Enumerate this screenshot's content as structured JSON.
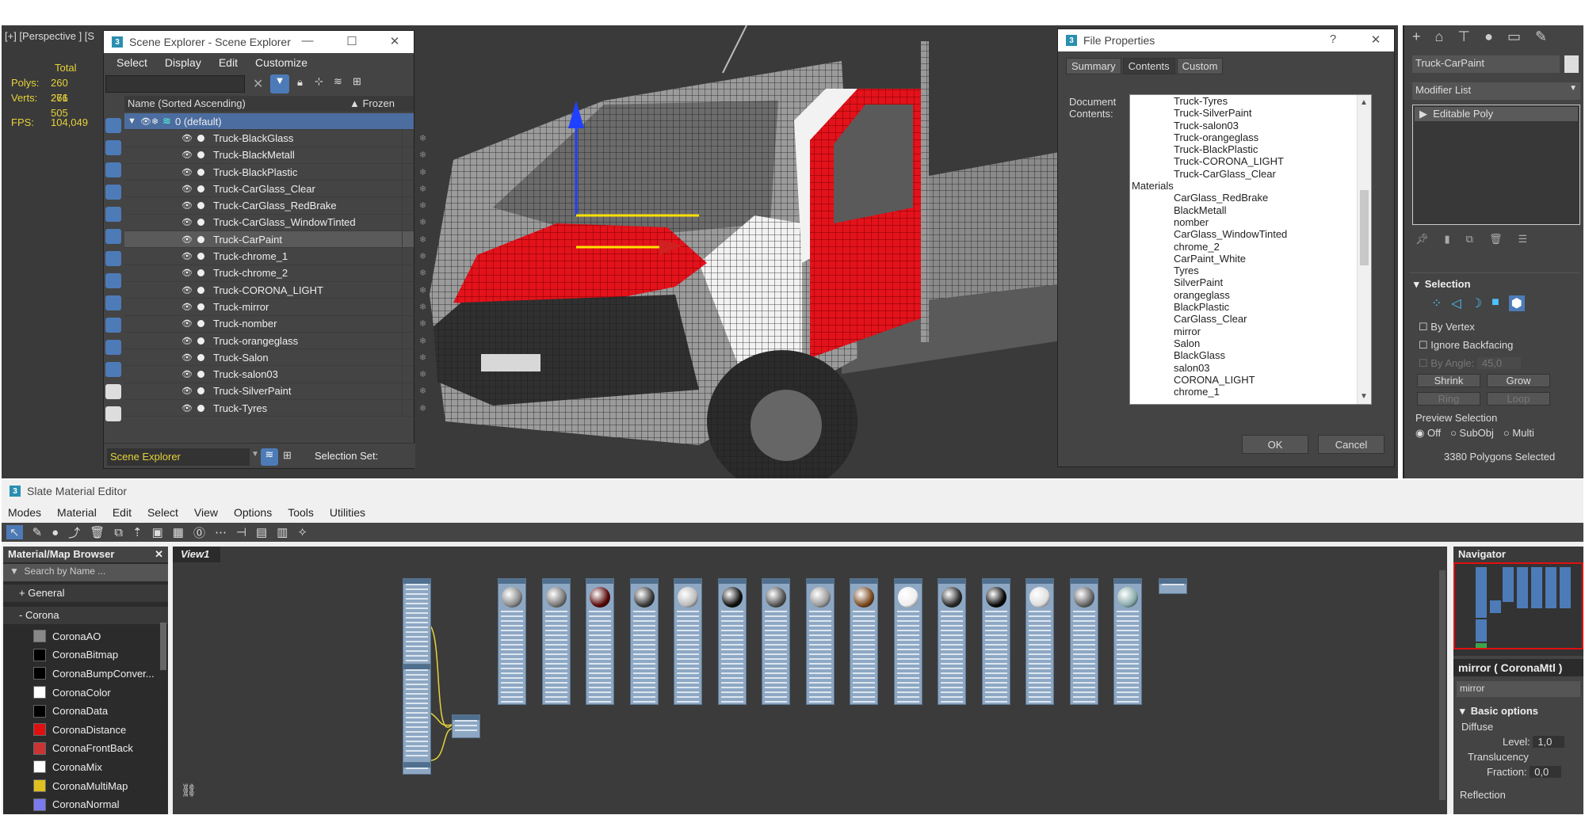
{
  "viewport": {
    "label": "[+] [Perspective ] [S",
    "stats": {
      "header": "Total",
      "polys_label": "Polys:",
      "polys": "260 261",
      "verts_label": "Verts:",
      "verts": "276 505",
      "fps_label": "FPS:",
      "fps": "104,049"
    }
  },
  "scene_explorer": {
    "title": "Scene Explorer - Scene Explorer",
    "menu": [
      "Select",
      "Display",
      "Edit",
      "Customize"
    ],
    "col_name": "Name (Sorted Ascending)",
    "col_frozen": "Frozen",
    "root": "0 (default)",
    "items": [
      "Truck-BlackGlass",
      "Truck-BlackMetall",
      "Truck-BlackPlastic",
      "Truck-CarGlass_Clear",
      "Truck-CarGlass_RedBrake",
      "Truck-CarGlass_WindowTinted",
      "Truck-CarPaint",
      "Truck-chrome_1",
      "Truck-chrome_2",
      "Truck-CORONA_LIGHT",
      "Truck-mirror",
      "Truck-nomber",
      "Truck-orangeglass",
      "Truck-Salon",
      "Truck-salon03",
      "Truck-SilverPaint",
      "Truck-Tyres"
    ],
    "selected_index": 6,
    "footer_dropdown": "Scene Explorer",
    "selection_set": "Selection Set:",
    "snow": "❄"
  },
  "file_props": {
    "title": "File Properties",
    "tabs": [
      "Summary",
      "Contents",
      "Custom"
    ],
    "active_tab": "Contents",
    "doc_label": "Document\nContents:",
    "list_top": [
      "Truck-Tyres",
      "Truck-SilverPaint",
      "Truck-salon03",
      "Truck-orangeglass",
      "Truck-BlackPlastic",
      "Truck-CORONA_LIGHT",
      "Truck-CarGlass_Clear"
    ],
    "materials_header": "Materials",
    "materials": [
      "CarGlass_RedBrake",
      "BlackMetall",
      "nomber",
      "CarGlass_WindowTinted",
      "chrome_2",
      "CarPaint_White",
      "Tyres",
      "SilverPaint",
      "orangeglass",
      "BlackPlastic",
      "CarGlass_Clear",
      "mirror",
      "Salon",
      "BlackGlass",
      "salon03",
      "CORONA_LIGHT",
      "chrome_1"
    ],
    "ok": "OK",
    "cancel": "Cancel"
  },
  "command_panel": {
    "object_name": "Truck-CarPaint",
    "modifier_list": "Modifier List",
    "stack_item": "Editable Poly",
    "selection_header": "Selection",
    "by_vertex": "By Vertex",
    "ignore_backfacing": "Ignore Backfacing",
    "by_angle": "By Angle:",
    "angle_value": "45,0",
    "shrink": "Shrink",
    "grow": "Grow",
    "ring": "Ring",
    "loop": "Loop",
    "preview_label": "Preview Selection",
    "preview_opts": [
      "Off",
      "SubObj",
      "Multi"
    ],
    "status": "3380 Polygons Selected"
  },
  "sme": {
    "title": "Slate Material Editor",
    "menu": [
      "Modes",
      "Material",
      "Edit",
      "Select",
      "View",
      "Options",
      "Tools",
      "Utilities"
    ],
    "browser_title": "Material/Map Browser",
    "search_placeholder": "Search by Name ...",
    "general": "+ General",
    "corona": "- Corona",
    "maps": [
      {
        "name": "CoronaAO",
        "color": "#888888"
      },
      {
        "name": "CoronaBitmap",
        "color": "#000000"
      },
      {
        "name": "CoronaBumpConver...",
        "color": "#000000"
      },
      {
        "name": "CoronaColor",
        "color": "#ffffff"
      },
      {
        "name": "CoronaData",
        "color": "#000000"
      },
      {
        "name": "CoronaDistance",
        "color": "#e01010"
      },
      {
        "name": "CoronaFrontBack",
        "color": "#cc3333"
      },
      {
        "name": "CoronaMix",
        "color": "#ffffff"
      },
      {
        "name": "CoronaMultiMap",
        "color": "#e0c020"
      },
      {
        "name": "CoronaNormal",
        "color": "#7a7aee"
      }
    ],
    "view_tab": "View1",
    "navigator": "Navigator",
    "param_title": "mirror  ( CoronaMtl )",
    "param_name": "mirror",
    "basic_options": "Basic options",
    "diffuse": "Diffuse",
    "level_label": "Level:",
    "level_value": "1,0",
    "translucency": "Translucency",
    "fraction_label": "Fraction:",
    "fraction_value": "0,0",
    "reflection": "Reflection"
  }
}
